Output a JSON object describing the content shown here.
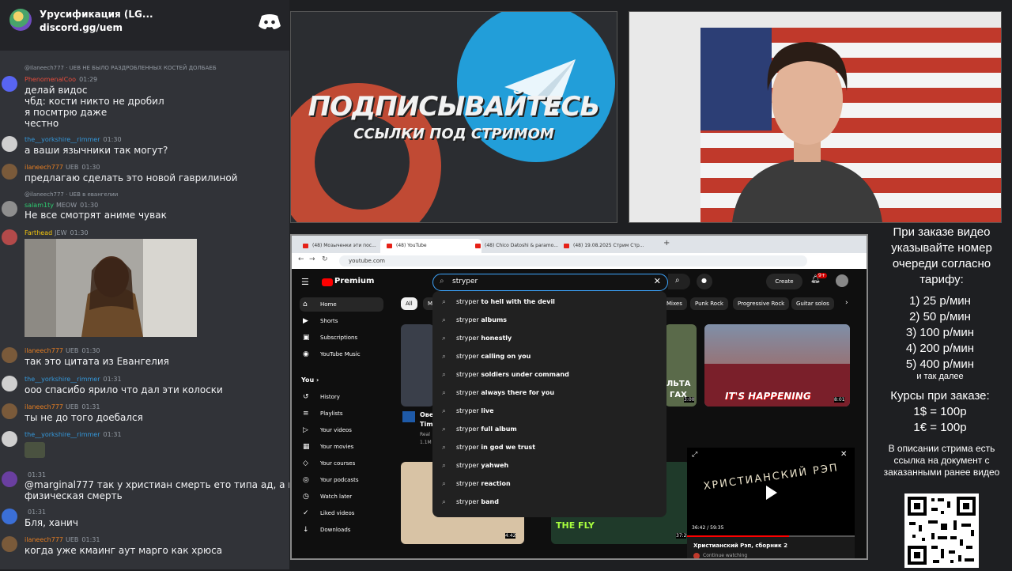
{
  "chat": {
    "header_title": "Урусификация (LG...",
    "header_subtitle": "discord.gg/uem",
    "messages": [
      {
        "quote": "@Ilaneech777 · UEB  НЕ БЫЛО РАЗДРОБЛЕННЫХ КОСТЕЙ ДОЛБАЕБ",
        "name": "PhenomenalCoo",
        "time": "01:29",
        "text": "делай видос\nчбд: кости никто не дробил\nя посмтрю даже\nчестно"
      },
      {
        "name": "the__yorkshire__rimmer",
        "time": "01:30",
        "text": "а ваши язычники так могут?"
      },
      {
        "name": "ilaneech777",
        "badge": "UEB",
        "time": "01:30",
        "text": "предлагаю сделать это новой гаврилиной"
      },
      {
        "quote": "@ilaneech777 · UEB  в евангелии",
        "name": "salam1ty",
        "badge": "MEOW",
        "time": "01:30",
        "text": "Не все смотрят аниме чувак"
      },
      {
        "name": "Farthead",
        "badge": "JEW",
        "time": "01:30",
        "text": ""
      },
      {
        "name": "ilaneech777",
        "badge": "UEB",
        "time": "01:30",
        "text": "так это цитата из Евангелия"
      },
      {
        "name": "the__yorkshire__rimmer",
        "time": "01:31",
        "text": "ооо спасибо ярило что дал эти колоски"
      },
      {
        "name": "ilaneech777",
        "badge": "UEB",
        "time": "01:31",
        "text": "ты не до того доебался"
      },
      {
        "name": "the__yorkshire__rimmer",
        "time": "01:31",
        "text": ""
      },
      {
        "name": "",
        "time": "01:31",
        "text": "@marginal777 так у христиан смерть ето типа ад, а не\nфизическая смерть"
      },
      {
        "name": "",
        "time": "01:31",
        "text": "Бля, ханич"
      },
      {
        "name": "ilaneech777",
        "badge": "UEB",
        "time": "01:31",
        "text": "когда уже кмаинг аут марго как хрюса"
      }
    ]
  },
  "banner": {
    "headline": "ПОДПИСЫВАЙТЕСЬ",
    "subline": "ССЫЛКИ ПОД СТРИМОМ"
  },
  "side_panel": {
    "order_title": "При заказе видео указывайте номер очереди согласно тарифу:",
    "tariffs": [
      "1) 25 р/мин",
      "2) 50 р/мин",
      "3) 100 р/мин",
      "4) 200 р/мин",
      "5) 400 р/мин"
    ],
    "etc": "и так далее",
    "rates_title": "Курсы при заказе:",
    "rates": [
      "1$ = 100р",
      "1€ = 100р"
    ],
    "description_note": "В описании стрима есть ссылка на документ с заказанными ранее видео"
  },
  "browser": {
    "tabs": [
      "(48) Мозыченки эти пос...",
      "(48) YouTube",
      "(48) Chico Datoshi & paramo...",
      "(48) 19.08.2025 Стрим Стр..."
    ],
    "url": "youtube.com",
    "youtube": {
      "logo": "Premium",
      "search_value": "stryper",
      "create_label": "Create",
      "notif_count": "9+",
      "sidebar": [
        "Home",
        "Shorts",
        "Subscriptions",
        "YouTube Music"
      ],
      "you_label": "You",
      "you_items": [
        "History",
        "Playlists",
        "Your videos",
        "Your movies",
        "Your courses",
        "Your podcasts",
        "Watch later",
        "Liked videos",
        "Downloads"
      ],
      "chips": [
        "All",
        "M",
        "Mixes",
        "Punk Rock",
        "Progressive Rock",
        "Guitar solos"
      ],
      "suggestions": [
        {
          "prefix": "stryper",
          "rest": " to hell with the devil"
        },
        {
          "prefix": "stryper",
          "rest": " albums"
        },
        {
          "prefix": "stryper",
          "rest": " honestly"
        },
        {
          "prefix": "stryper",
          "rest": " calling on you"
        },
        {
          "prefix": "stryper",
          "rest": " soldiers under command"
        },
        {
          "prefix": "stryper",
          "rest": " always there for you"
        },
        {
          "prefix": "stryper",
          "rest": " live"
        },
        {
          "prefix": "stryper",
          "rest": " full album"
        },
        {
          "prefix": "stryper",
          "rest": " in god we trust"
        },
        {
          "prefix": "stryper",
          "rest": " yahweh"
        },
        {
          "prefix": "stryper",
          "rest": " reaction"
        },
        {
          "prefix": "stryper",
          "rest": " band"
        }
      ],
      "thumb_texts": [
        "IT'S HAPPENING",
        "8:01",
        "3:00",
        "4:42",
        "THE FLY",
        "37:2",
        "Ове",
        "Tim",
        "Real",
        "1.1M",
        "ЛЬТА",
        "ГАХ"
      ],
      "miniplayer": {
        "overlay_text": "ХРИСТИАНСКИЙ РЭП",
        "time": "36:42 / 59:35",
        "title": "Христианский Рэп, сборник 2",
        "status": "Continue watching"
      }
    }
  }
}
